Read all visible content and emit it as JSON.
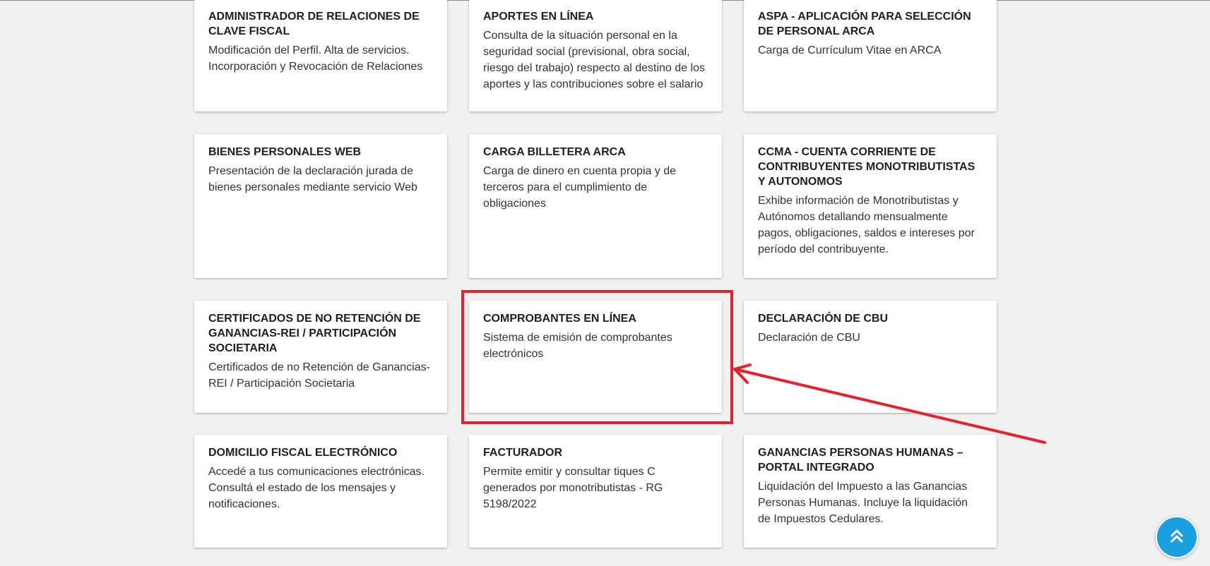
{
  "cards": [
    {
      "title": "ADMINISTRADOR DE RELACIONES DE CLAVE FISCAL",
      "description": "Modificación del Perfil. Alta de servicios. Incorporación y Revocación de Relaciones"
    },
    {
      "title": "APORTES EN LÍNEA",
      "description": "Consulta de la situación personal en la seguridad social (previsional, obra social, riesgo del trabajo) respecto al destino de los aportes y las contribuciones sobre el salario"
    },
    {
      "title": "ASPA - APLICACIÓN PARA SELECCIÓN DE PERSONAL ARCA",
      "description": "Carga de Currículum Vitae en ARCA"
    },
    {
      "title": "BIENES PERSONALES WEB",
      "description": "Presentación de la declaración jurada de bienes personales mediante servicio Web"
    },
    {
      "title": "CARGA BILLETERA ARCA",
      "description": "Carga de dinero en cuenta propia y de terceros para el cumplimiento de obligaciones"
    },
    {
      "title": "CCMA - CUENTA CORRIENTE DE CONTRIBUYENTES MONOTRIBUTISTAS Y AUTONOMOS",
      "description": "Exhibe información de Monotributistas y Autónomos detallando mensualmente pagos, obligaciones, saldos e intereses por período del contribuyente."
    },
    {
      "title": "CERTIFICADOS DE NO RETENCIÓN DE GANANCIAS-REI / PARTICIPACIÓN SOCIETARIA",
      "description": "Certificados de no Retención de Ganancias-REI / Participación Societaria"
    },
    {
      "title": "COMPROBANTES EN LÍNEA",
      "description": "Sistema de emisión de comprobantes electrónicos"
    },
    {
      "title": "DECLARACIÓN DE CBU",
      "description": "Declaración de CBU"
    },
    {
      "title": "DOMICILIO FISCAL ELECTRÓNICO",
      "description": "Accedé a tus comunicaciones electrónicas. Consultá el estado de los mensajes y notificaciones."
    },
    {
      "title": "FACTURADOR",
      "description": "Permite emitir y consultar tiques C generados por monotributistas - RG 5198/2022"
    },
    {
      "title": "GANANCIAS PERSONAS HUMANAS – PORTAL INTEGRADO",
      "description": "Liquidación del Impuesto a las Ganancias Personas Humanas. Incluye la liquidación de Impuestos Cedulares."
    }
  ],
  "colors": {
    "background": "#f1f1f1",
    "card": "#ffffff",
    "annotation": "#e3232f",
    "scroll_button": "#1a9fe0"
  },
  "icons": {
    "scroll_top": "double-chevron-up-icon"
  }
}
